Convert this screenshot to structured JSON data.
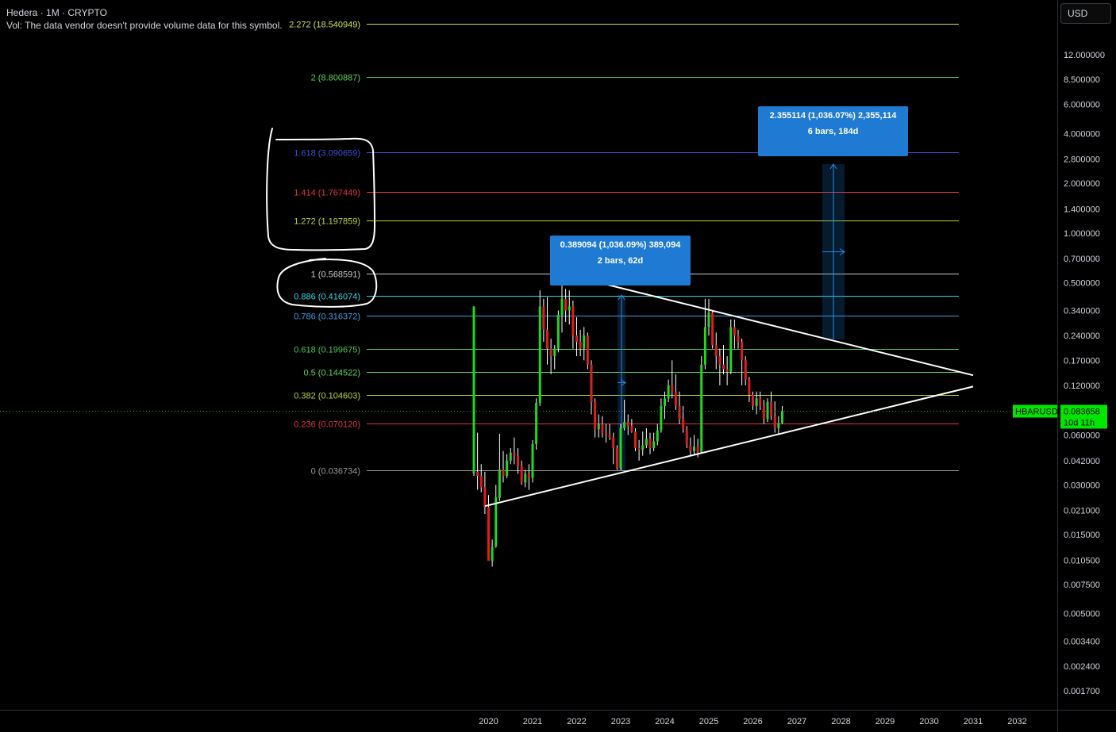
{
  "header": {
    "title": "Hedera · 1M · CRYPTO",
    "volume_note": "Vol: The data vendor doesn't provide volume data for this symbol."
  },
  "currency_button": "USD",
  "price_tag": {
    "symbol": "HBARUSD",
    "price": "0.083658",
    "countdown": "10d 11h",
    "color": "#00e600"
  },
  "colors": {
    "up": "#22d622",
    "down": "#e01e1e",
    "background": "#000000",
    "measure_box": "#1e7ad2",
    "trendline": "#ffffff"
  },
  "chart_data": {
    "type": "candlestick",
    "symbol": "HBARUSD",
    "interval": "1M",
    "y_scale": "log",
    "y_ticks": [
      12.0,
      8.5,
      6.0,
      4.0,
      2.8,
      2.0,
      1.4,
      1.0,
      0.7,
      0.5,
      0.34,
      0.24,
      0.17,
      0.12,
      0.06,
      0.042,
      0.03,
      0.021,
      0.015,
      0.0105,
      0.0075,
      0.005,
      0.0034,
      0.0024,
      0.0017
    ],
    "y_tick_labels": [
      "12.000000",
      "8.500000",
      "6.000000",
      "4.000000",
      "2.800000",
      "2.000000",
      "1.400000",
      "1.000000",
      "0.700000",
      "0.500000",
      "0.340000",
      "0.240000",
      "0.170000",
      "0.120000",
      "0.060000",
      "0.042000",
      "0.030000",
      "0.021000",
      "0.015000",
      "0.010500",
      "0.007500",
      "0.005000",
      "0.003400",
      "0.002400",
      "0.001700"
    ],
    "x_ticks": [
      "2020",
      "2021",
      "2022",
      "2023",
      "2024",
      "2025",
      "2026",
      "2027",
      "2028",
      "2029",
      "2030",
      "2031",
      "2032"
    ],
    "fib_levels": [
      {
        "ratio": "2.272",
        "price": 18.540949,
        "label": "2.272 (18.540949)",
        "color": "#c6e35a"
      },
      {
        "ratio": "2",
        "price": 8.800887,
        "label": "2 (8.800887)",
        "color": "#5fd35f"
      },
      {
        "ratio": "1.618",
        "price": 3.090659,
        "label": "1.618 (3.090659)",
        "color": "#3d52d5"
      },
      {
        "ratio": "1.414",
        "price": 1.767449,
        "label": "1.414 (1.767449)",
        "color": "#e0363c"
      },
      {
        "ratio": "1.272",
        "price": 1.197859,
        "label": "1.272 (1.197859)",
        "color": "#b5d536"
      },
      {
        "ratio": "1",
        "price": 0.568591,
        "label": "1 (0.568591)",
        "color": "#c8c8c8"
      },
      {
        "ratio": "0.886",
        "price": 0.416074,
        "label": "0.886 (0.416074)",
        "color": "#33d6e6"
      },
      {
        "ratio": "0.786",
        "price": 0.316372,
        "label": "0.786 (0.316372)",
        "color": "#3d9fe0"
      },
      {
        "ratio": "0.618",
        "price": 0.199675,
        "label": "0.618 (0.199675)",
        "color": "#4cc85a"
      },
      {
        "ratio": "0.5",
        "price": 0.144522,
        "label": "0.5 (0.144522)",
        "color": "#5fd35f"
      },
      {
        "ratio": "0.382",
        "price": 0.104603,
        "label": "0.382 (0.104603)",
        "color": "#b5d536"
      },
      {
        "ratio": "0.236",
        "price": 0.07012,
        "label": "0.236 (0.070120)",
        "color": "#e0363c"
      },
      {
        "ratio": "0",
        "price": 0.036734,
        "label": "0 (0.036734)",
        "color": "#9a9a9a"
      }
    ],
    "measurements": [
      {
        "line1": "0.389094 (1,036.09%) 389,094",
        "line2": "2 bars, 62d"
      },
      {
        "line1": "2.355114 (1,036.07%) 2,355,114",
        "line2": "6 bars, 184d"
      }
    ],
    "trendlines": [
      {
        "from": {
          "date": "2019-12",
          "price": 0.0223
        },
        "to": {
          "date": "2031-01",
          "price": 0.118
        }
      },
      {
        "from": {
          "date": "2021-09",
          "price": 0.57
        },
        "to": {
          "date": "2031-01",
          "price": 0.138
        }
      }
    ],
    "candles": [
      {
        "date": "2019-09",
        "o": 0.0352,
        "h": 0.36,
        "l": 0.034,
        "c": 0.36
      },
      {
        "date": "2019-10",
        "o": 0.036,
        "h": 0.062,
        "l": 0.028,
        "c": 0.034
      },
      {
        "date": "2019-11",
        "o": 0.034,
        "h": 0.04,
        "l": 0.027,
        "c": 0.029
      },
      {
        "date": "2019-12",
        "o": 0.029,
        "h": 0.036,
        "l": 0.02,
        "c": 0.022
      },
      {
        "date": "2020-01",
        "o": 0.022,
        "h": 0.026,
        "l": 0.0105,
        "c": 0.0104
      },
      {
        "date": "2020-02",
        "o": 0.0104,
        "h": 0.014,
        "l": 0.0096,
        "c": 0.0127
      },
      {
        "date": "2020-03",
        "o": 0.0127,
        "h": 0.03,
        "l": 0.0125,
        "c": 0.0252
      },
      {
        "date": "2020-04",
        "o": 0.025,
        "h": 0.061,
        "l": 0.024,
        "c": 0.037
      },
      {
        "date": "2020-05",
        "o": 0.037,
        "h": 0.048,
        "l": 0.031,
        "c": 0.034
      },
      {
        "date": "2020-06",
        "o": 0.034,
        "h": 0.046,
        "l": 0.033,
        "c": 0.042
      },
      {
        "date": "2020-07",
        "o": 0.042,
        "h": 0.05,
        "l": 0.04,
        "c": 0.047
      },
      {
        "date": "2020-08",
        "o": 0.047,
        "h": 0.058,
        "l": 0.04,
        "c": 0.045
      },
      {
        "date": "2020-09",
        "o": 0.045,
        "h": 0.05,
        "l": 0.035,
        "c": 0.039
      },
      {
        "date": "2020-10",
        "o": 0.039,
        "h": 0.042,
        "l": 0.03,
        "c": 0.031
      },
      {
        "date": "2020-11",
        "o": 0.031,
        "h": 0.037,
        "l": 0.029,
        "c": 0.035
      },
      {
        "date": "2020-12",
        "o": 0.035,
        "h": 0.04,
        "l": 0.028,
        "c": 0.033
      },
      {
        "date": "2021-01",
        "o": 0.033,
        "h": 0.056,
        "l": 0.031,
        "c": 0.053
      },
      {
        "date": "2021-02",
        "o": 0.053,
        "h": 0.1,
        "l": 0.049,
        "c": 0.094
      },
      {
        "date": "2021-03",
        "o": 0.094,
        "h": 0.45,
        "l": 0.09,
        "c": 0.36
      },
      {
        "date": "2021-04",
        "o": 0.36,
        "h": 0.4,
        "l": 0.22,
        "c": 0.26
      },
      {
        "date": "2021-05",
        "o": 0.26,
        "h": 0.41,
        "l": 0.16,
        "c": 0.2
      },
      {
        "date": "2021-06",
        "o": 0.2,
        "h": 0.23,
        "l": 0.14,
        "c": 0.18
      },
      {
        "date": "2021-07",
        "o": 0.18,
        "h": 0.21,
        "l": 0.15,
        "c": 0.2
      },
      {
        "date": "2021-08",
        "o": 0.2,
        "h": 0.34,
        "l": 0.19,
        "c": 0.32
      },
      {
        "date": "2021-09",
        "o": 0.32,
        "h": 0.57,
        "l": 0.25,
        "c": 0.4
      },
      {
        "date": "2021-10",
        "o": 0.4,
        "h": 0.46,
        "l": 0.29,
        "c": 0.34
      },
      {
        "date": "2021-11",
        "o": 0.34,
        "h": 0.45,
        "l": 0.28,
        "c": 0.36
      },
      {
        "date": "2021-12",
        "o": 0.36,
        "h": 0.39,
        "l": 0.2,
        "c": 0.24
      },
      {
        "date": "2022-01",
        "o": 0.24,
        "h": 0.31,
        "l": 0.18,
        "c": 0.22
      },
      {
        "date": "2022-02",
        "o": 0.22,
        "h": 0.26,
        "l": 0.18,
        "c": 0.2
      },
      {
        "date": "2022-03",
        "o": 0.2,
        "h": 0.27,
        "l": 0.17,
        "c": 0.24
      },
      {
        "date": "2022-04",
        "o": 0.24,
        "h": 0.25,
        "l": 0.15,
        "c": 0.16
      },
      {
        "date": "2022-05",
        "o": 0.16,
        "h": 0.17,
        "l": 0.08,
        "c": 0.095
      },
      {
        "date": "2022-06",
        "o": 0.095,
        "h": 0.1,
        "l": 0.058,
        "c": 0.065
      },
      {
        "date": "2022-07",
        "o": 0.065,
        "h": 0.08,
        "l": 0.058,
        "c": 0.07
      },
      {
        "date": "2022-08",
        "o": 0.07,
        "h": 0.078,
        "l": 0.058,
        "c": 0.062
      },
      {
        "date": "2022-09",
        "o": 0.062,
        "h": 0.07,
        "l": 0.054,
        "c": 0.06
      },
      {
        "date": "2022-10",
        "o": 0.06,
        "h": 0.07,
        "l": 0.056,
        "c": 0.058
      },
      {
        "date": "2022-11",
        "o": 0.058,
        "h": 0.062,
        "l": 0.04,
        "c": 0.05
      },
      {
        "date": "2022-12",
        "o": 0.05,
        "h": 0.052,
        "l": 0.037,
        "c": 0.038
      },
      {
        "date": "2023-01",
        "o": 0.038,
        "h": 0.07,
        "l": 0.037,
        "c": 0.066
      },
      {
        "date": "2023-02",
        "o": 0.066,
        "h": 0.098,
        "l": 0.064,
        "c": 0.072
      },
      {
        "date": "2023-03",
        "o": 0.072,
        "h": 0.08,
        "l": 0.06,
        "c": 0.068
      },
      {
        "date": "2023-04",
        "o": 0.068,
        "h": 0.075,
        "l": 0.062,
        "c": 0.063
      },
      {
        "date": "2023-05",
        "o": 0.063,
        "h": 0.066,
        "l": 0.048,
        "c": 0.05
      },
      {
        "date": "2023-06",
        "o": 0.05,
        "h": 0.056,
        "l": 0.042,
        "c": 0.049
      },
      {
        "date": "2023-07",
        "o": 0.049,
        "h": 0.063,
        "l": 0.045,
        "c": 0.052
      },
      {
        "date": "2023-08",
        "o": 0.052,
        "h": 0.066,
        "l": 0.05,
        "c": 0.057
      },
      {
        "date": "2023-09",
        "o": 0.057,
        "h": 0.062,
        "l": 0.046,
        "c": 0.05
      },
      {
        "date": "2023-10",
        "o": 0.05,
        "h": 0.062,
        "l": 0.048,
        "c": 0.055
      },
      {
        "date": "2023-11",
        "o": 0.055,
        "h": 0.07,
        "l": 0.052,
        "c": 0.064
      },
      {
        "date": "2023-12",
        "o": 0.064,
        "h": 0.1,
        "l": 0.062,
        "c": 0.09
      },
      {
        "date": "2024-01",
        "o": 0.09,
        "h": 0.11,
        "l": 0.075,
        "c": 0.1
      },
      {
        "date": "2024-02",
        "o": 0.1,
        "h": 0.13,
        "l": 0.095,
        "c": 0.12
      },
      {
        "date": "2024-03",
        "o": 0.12,
        "h": 0.17,
        "l": 0.1,
        "c": 0.11
      },
      {
        "date": "2024-04",
        "o": 0.11,
        "h": 0.14,
        "l": 0.085,
        "c": 0.09
      },
      {
        "date": "2024-05",
        "o": 0.09,
        "h": 0.11,
        "l": 0.07,
        "c": 0.075
      },
      {
        "date": "2024-06",
        "o": 0.075,
        "h": 0.09,
        "l": 0.062,
        "c": 0.065
      },
      {
        "date": "2024-07",
        "o": 0.065,
        "h": 0.068,
        "l": 0.05,
        "c": 0.052
      },
      {
        "date": "2024-08",
        "o": 0.052,
        "h": 0.058,
        "l": 0.045,
        "c": 0.048
      },
      {
        "date": "2024-09",
        "o": 0.048,
        "h": 0.06,
        "l": 0.045,
        "c": 0.051
      },
      {
        "date": "2024-10",
        "o": 0.051,
        "h": 0.057,
        "l": 0.044,
        "c": 0.047
      },
      {
        "date": "2024-11",
        "o": 0.047,
        "h": 0.18,
        "l": 0.047,
        "c": 0.16
      },
      {
        "date": "2024-12",
        "o": 0.16,
        "h": 0.4,
        "l": 0.15,
        "c": 0.27
      },
      {
        "date": "2025-01",
        "o": 0.27,
        "h": 0.4,
        "l": 0.24,
        "c": 0.33
      },
      {
        "date": "2025-02",
        "o": 0.33,
        "h": 0.34,
        "l": 0.2,
        "c": 0.21
      },
      {
        "date": "2025-03",
        "o": 0.21,
        "h": 0.25,
        "l": 0.15,
        "c": 0.18
      },
      {
        "date": "2025-04",
        "o": 0.18,
        "h": 0.2,
        "l": 0.12,
        "c": 0.16
      },
      {
        "date": "2025-05",
        "o": 0.16,
        "h": 0.21,
        "l": 0.14,
        "c": 0.15
      },
      {
        "date": "2025-06",
        "o": 0.15,
        "h": 0.18,
        "l": 0.12,
        "c": 0.145
      },
      {
        "date": "2025-07",
        "o": 0.145,
        "h": 0.3,
        "l": 0.14,
        "c": 0.27
      },
      {
        "date": "2025-08",
        "o": 0.27,
        "h": 0.3,
        "l": 0.2,
        "c": 0.24
      },
      {
        "date": "2025-09",
        "o": 0.24,
        "h": 0.26,
        "l": 0.2,
        "c": 0.22
      },
      {
        "date": "2025-10",
        "o": 0.22,
        "h": 0.23,
        "l": 0.12,
        "c": 0.17
      },
      {
        "date": "2025-11",
        "o": 0.17,
        "h": 0.18,
        "l": 0.12,
        "c": 0.13
      },
      {
        "date": "2025-12",
        "o": 0.13,
        "h": 0.135,
        "l": 0.095,
        "c": 0.105
      },
      {
        "date": "2026-01",
        "o": 0.105,
        "h": 0.11,
        "l": 0.085,
        "c": 0.09
      },
      {
        "date": "2026-02",
        "o": 0.09,
        "h": 0.11,
        "l": 0.08,
        "c": 0.1
      },
      {
        "date": "2026-03",
        "o": 0.1,
        "h": 0.11,
        "l": 0.085,
        "c": 0.09
      },
      {
        "date": "2026-04",
        "o": 0.09,
        "h": 0.098,
        "l": 0.07,
        "c": 0.075
      },
      {
        "date": "2026-05",
        "o": 0.075,
        "h": 0.1,
        "l": 0.072,
        "c": 0.095
      },
      {
        "date": "2026-06",
        "o": 0.095,
        "h": 0.11,
        "l": 0.074,
        "c": 0.078
      },
      {
        "date": "2026-07",
        "o": 0.078,
        "h": 0.096,
        "l": 0.062,
        "c": 0.066
      },
      {
        "date": "2026-08",
        "o": 0.066,
        "h": 0.078,
        "l": 0.06,
        "c": 0.071
      },
      {
        "date": "2026-09",
        "o": 0.071,
        "h": 0.09,
        "l": 0.07,
        "c": 0.0837
      }
    ]
  }
}
